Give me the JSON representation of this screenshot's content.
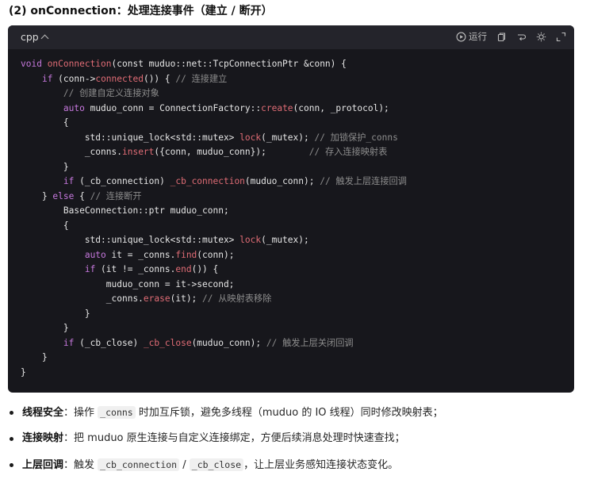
{
  "heading": {
    "prefix": "(2) onConnection",
    "sep": "：",
    "title": "处理连接事件（建立 / 断开）"
  },
  "code_block": {
    "language": "cpp",
    "run_label": "运行",
    "icons": [
      "chevron-up-icon",
      "play-icon",
      "copy-icon",
      "wrap-icon",
      "theme-icon",
      "expand-icon"
    ],
    "lines": [
      [
        [
          "kw",
          "void "
        ],
        [
          "fn",
          "onConnection"
        ],
        [
          "t",
          "(const muduo::net::TcpConnectionPtr &conn) {"
        ]
      ],
      [
        [
          "t",
          "    "
        ],
        [
          "kw",
          "if"
        ],
        [
          "t",
          " (conn->"
        ],
        [
          "fn",
          "connected"
        ],
        [
          "t",
          "()) { "
        ],
        [
          "cm",
          "// 连接建立"
        ]
      ],
      [
        [
          "t",
          "        "
        ],
        [
          "cm",
          "// 创建自定义连接对象"
        ]
      ],
      [
        [
          "t",
          "        "
        ],
        [
          "kw",
          "auto"
        ],
        [
          "t",
          " muduo_conn = ConnectionFactory::"
        ],
        [
          "fn",
          "create"
        ],
        [
          "t",
          "(conn, _protocol);"
        ]
      ],
      [
        [
          "t",
          "        {"
        ]
      ],
      [
        [
          "t",
          "            std::unique_lock<std::mutex> "
        ],
        [
          "fn",
          "lock"
        ],
        [
          "t",
          "(_mutex); "
        ],
        [
          "cm",
          "// 加锁保护_conns"
        ]
      ],
      [
        [
          "t",
          "            _conns."
        ],
        [
          "fn",
          "insert"
        ],
        [
          "t",
          "({conn, muduo_conn});        "
        ],
        [
          "cm",
          "// 存入连接映射表"
        ]
      ],
      [
        [
          "t",
          "        }"
        ]
      ],
      [
        [
          "t",
          "        "
        ],
        [
          "kw",
          "if"
        ],
        [
          "t",
          " (_cb_connection) "
        ],
        [
          "fn",
          "_cb_connection"
        ],
        [
          "t",
          "(muduo_conn); "
        ],
        [
          "cm",
          "// 触发上层连接回调"
        ]
      ],
      [
        [
          "t",
          "    } "
        ],
        [
          "kw",
          "else"
        ],
        [
          "t",
          " { "
        ],
        [
          "cm",
          "// 连接断开"
        ]
      ],
      [
        [
          "t",
          "        BaseConnection::ptr muduo_conn;"
        ]
      ],
      [
        [
          "t",
          "        {"
        ]
      ],
      [
        [
          "t",
          "            std::unique_lock<std::mutex> "
        ],
        [
          "fn",
          "lock"
        ],
        [
          "t",
          "(_mutex);"
        ]
      ],
      [
        [
          "t",
          "            "
        ],
        [
          "kw",
          "auto"
        ],
        [
          "t",
          " it = _conns."
        ],
        [
          "fn",
          "find"
        ],
        [
          "t",
          "(conn);"
        ]
      ],
      [
        [
          "t",
          "            "
        ],
        [
          "kw",
          "if"
        ],
        [
          "t",
          " (it != _conns."
        ],
        [
          "fn",
          "end"
        ],
        [
          "t",
          "()) {"
        ]
      ],
      [
        [
          "t",
          "                muduo_conn = it->second;"
        ]
      ],
      [
        [
          "t",
          "                _conns."
        ],
        [
          "fn",
          "erase"
        ],
        [
          "t",
          "(it); "
        ],
        [
          "cm",
          "// 从映射表移除"
        ]
      ],
      [
        [
          "t",
          "            }"
        ]
      ],
      [
        [
          "t",
          "        }"
        ]
      ],
      [
        [
          "t",
          "        "
        ],
        [
          "kw",
          "if"
        ],
        [
          "t",
          " (_cb_close) "
        ],
        [
          "fn",
          "_cb_close"
        ],
        [
          "t",
          "(muduo_conn); "
        ],
        [
          "cm",
          "// 触发上层关闭回调"
        ]
      ],
      [
        [
          "t",
          "    }"
        ]
      ],
      [
        [
          "t",
          "}"
        ]
      ]
    ]
  },
  "bullets": [
    {
      "title": "线程安全",
      "colon": "：",
      "parts": [
        [
          "t",
          "操作 "
        ],
        [
          "c",
          "_conns"
        ],
        [
          "t",
          " 时加互斥锁，避免多线程（muduo 的 IO 线程）同时修改映射表；"
        ]
      ]
    },
    {
      "title": "连接映射",
      "colon": "：",
      "parts": [
        [
          "t",
          "把 muduo 原生连接与自定义连接绑定，方便后续消息处理时快速查找；"
        ]
      ]
    },
    {
      "title": "上层回调",
      "colon": "：",
      "parts": [
        [
          "t",
          "触发 "
        ],
        [
          "c",
          "_cb_connection"
        ],
        [
          "t",
          " / "
        ],
        [
          "c",
          "_cb_close"
        ],
        [
          "t",
          "，让上层业务感知连接状态变化。"
        ]
      ]
    }
  ]
}
